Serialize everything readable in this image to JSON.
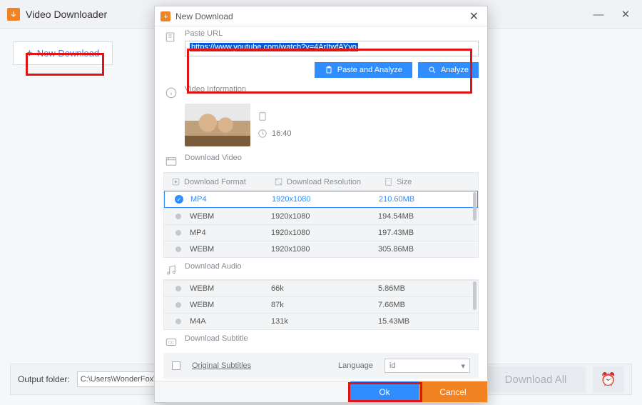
{
  "main": {
    "title": "Video Downloader",
    "new_download": "New Download",
    "output_label": "Output folder:",
    "output_value": "C:\\Users\\WonderFox\\Documents",
    "download_all": "Download All"
  },
  "dialog": {
    "title": "New Download",
    "paste_url_label": "Paste URL",
    "url_value": "https://www.youtube.com/watch?v=4ArItwfAYyo",
    "paste_analyze": "Paste and Analyze",
    "analyze": "Analyze",
    "video_info_label": "Video Information",
    "duration": "16:40",
    "download_video_label": "Download Video",
    "headers": {
      "format": "Download Format",
      "resolution": "Download Resolution",
      "size": "Size"
    },
    "video_rows": [
      {
        "format": "MP4",
        "resolution": "1920x1080",
        "size": "210.60MB",
        "selected": true
      },
      {
        "format": "WEBM",
        "resolution": "1920x1080",
        "size": "194.54MB",
        "selected": false
      },
      {
        "format": "MP4",
        "resolution": "1920x1080",
        "size": "197.43MB",
        "selected": false
      },
      {
        "format": "WEBM",
        "resolution": "1920x1080",
        "size": "305.86MB",
        "selected": false
      }
    ],
    "download_audio_label": "Download Audio",
    "audio_rows": [
      {
        "format": "WEBM",
        "bitrate": "66k",
        "size": "5.86MB"
      },
      {
        "format": "WEBM",
        "bitrate": "87k",
        "size": "7.66MB"
      },
      {
        "format": "M4A",
        "bitrate": "131k",
        "size": "15.43MB"
      }
    ],
    "download_subtitle_label": "Download Subtitle",
    "original_subtitles": "Original Subtitles",
    "language_label": "Language",
    "language_value": "id",
    "ok": "Ok",
    "cancel": "Cancel"
  }
}
